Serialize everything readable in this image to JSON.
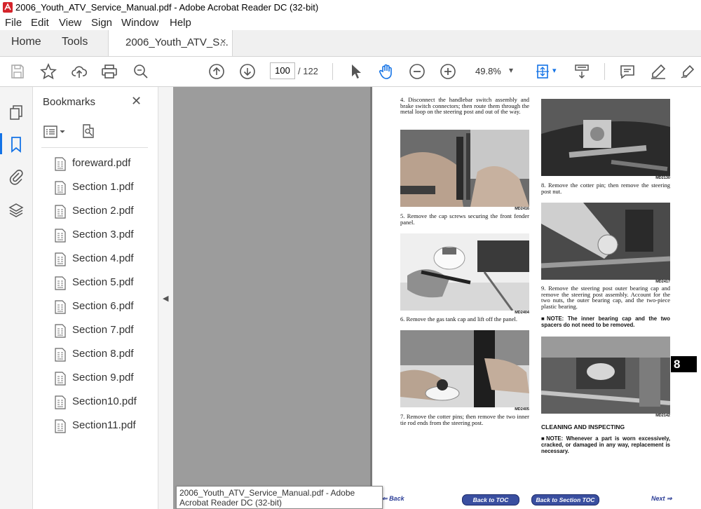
{
  "window": {
    "title": "2006_Youth_ATV_Service_Manual.pdf - Adobe Acrobat Reader DC (32-bit)"
  },
  "menu": [
    "File",
    "Edit",
    "View",
    "Sign",
    "Window",
    "Help"
  ],
  "tabs": {
    "home": "Home",
    "tools": "Tools",
    "document": "2006_Youth_ATV_S...",
    "close": "×"
  },
  "toolbar": {
    "page_current": "100",
    "page_total": "/ 122",
    "zoom": "49.8%"
  },
  "bookmarks": {
    "title": "Bookmarks",
    "close": "✕",
    "items": [
      "foreward.pdf",
      "Section 1.pdf",
      "Section 2.pdf",
      "Section 3.pdf",
      "Section 4.pdf",
      "Section 5.pdf",
      "Section 6.pdf",
      "Section 7.pdf",
      "Section 8.pdf",
      "Section 9.pdf",
      "Section10.pdf",
      "Section11.pdf"
    ]
  },
  "page": {
    "step4": "4. Disconnect the handlebar switch assembly and brake switch connectors; then route them through the metal loop on the steering post and out of the way.",
    "fig1_code": "MD2416",
    "step5": "5. Remove the cap screws securing the front fender panel.",
    "fig2_code": "MD2404",
    "step6": "6. Remove the gas tank cap and lift off the panel.",
    "fig3_code": "MD2405",
    "step7": "7. Remove the cotter pins; then remove the two inner tie rod ends from the steering post.",
    "fig4_code": "MD2130",
    "step8": "8. Remove the cotter pin; then remove the steering post nut.",
    "fig5_code": "MD2417",
    "step9": "9. Remove the steering post outer bearing cap and remove the steering post assembly. Account for the two nuts, the outer bearing cap, and the two-piece plastic bearing.",
    "note1": "■NOTE: The inner bearing cap and the two spacers do not need to be removed.",
    "fig6_code": "MD2142",
    "heading": "CLEANING AND INSPECTING",
    "note2": "■NOTE: Whenever a part is worn excessively, cracked, or damaged in any way, replacement is necessary.",
    "section_number": "8",
    "nav_back": "Back",
    "nav_toc": "Back to TOC",
    "nav_section_toc": "Back to Section TOC",
    "nav_next": "Next"
  },
  "tooltip": "2006_Youth_ATV_Service_Manual.pdf - Adobe Acrobat Reader DC (32-bit)",
  "colors": {
    "acrobat_red": "#d4242b",
    "bookmark_blue": "#1473e6",
    "nav_blue": "#3a4fa0"
  }
}
